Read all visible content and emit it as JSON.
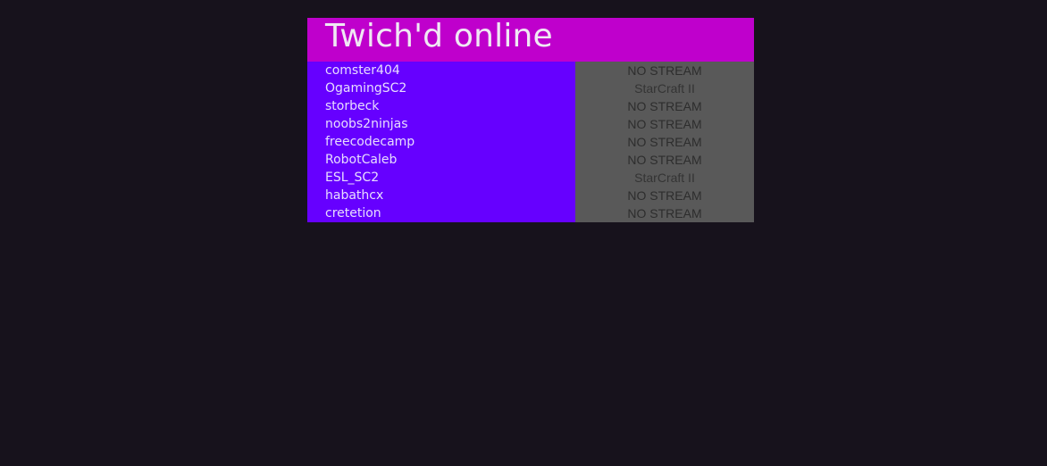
{
  "app": {
    "title": "Twich'd online"
  },
  "colors": {
    "background": "#17121c",
    "header": "#bf00cc",
    "name_column": "#6600ff",
    "status_column": "#595959"
  },
  "channels": [
    {
      "name": "comster404",
      "status": "NO STREAM"
    },
    {
      "name": "OgamingSC2",
      "status": "StarCraft II"
    },
    {
      "name": "storbeck",
      "status": "NO STREAM"
    },
    {
      "name": "noobs2ninjas",
      "status": "NO STREAM"
    },
    {
      "name": "freecodecamp",
      "status": "NO STREAM"
    },
    {
      "name": "RobotCaleb",
      "status": "NO STREAM"
    },
    {
      "name": "ESL_SC2",
      "status": "StarCraft II"
    },
    {
      "name": "habathcx",
      "status": "NO STREAM"
    },
    {
      "name": "cretetion",
      "status": "NO STREAM"
    }
  ]
}
